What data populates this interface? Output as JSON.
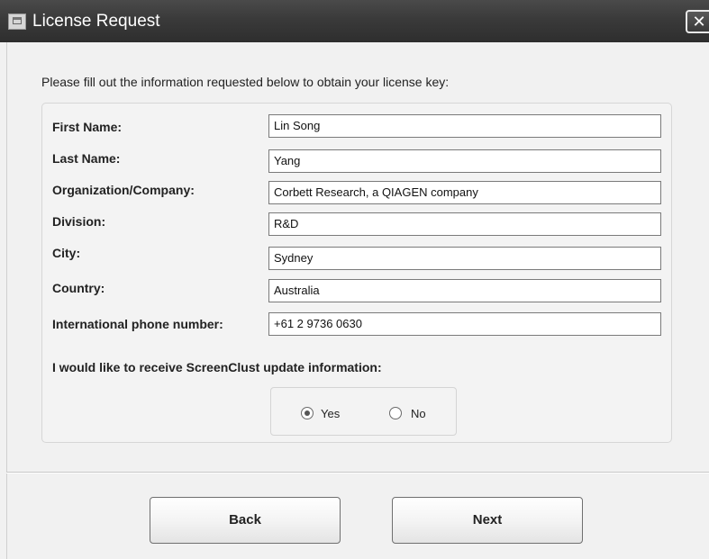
{
  "window": {
    "title": "License Request",
    "close_glyph": "✕",
    "app_icon": "license-app-icon"
  },
  "form": {
    "instruction": "Please fill out the information requested below to obtain your license key:",
    "fields": [
      {
        "label": "First Name:",
        "value": "Lin Song"
      },
      {
        "label": "Last Name:",
        "value": "Yang"
      },
      {
        "label": "Organization/Company:",
        "value": "Corbett Research, a QIAGEN company"
      },
      {
        "label": "Division:",
        "value": "R&D"
      },
      {
        "label": "City:",
        "value": "Sydney"
      },
      {
        "label": "Country:",
        "value": "Australia"
      },
      {
        "label": "International phone number:",
        "value": "+61 2 9736 0630"
      }
    ],
    "updates_question": "I would like to receive ScreenClust update information:",
    "updates_options": [
      {
        "label": "Yes",
        "selected": true
      },
      {
        "label": "No",
        "selected": false
      }
    ]
  },
  "buttons": {
    "back": "Back",
    "next": "Next"
  }
}
